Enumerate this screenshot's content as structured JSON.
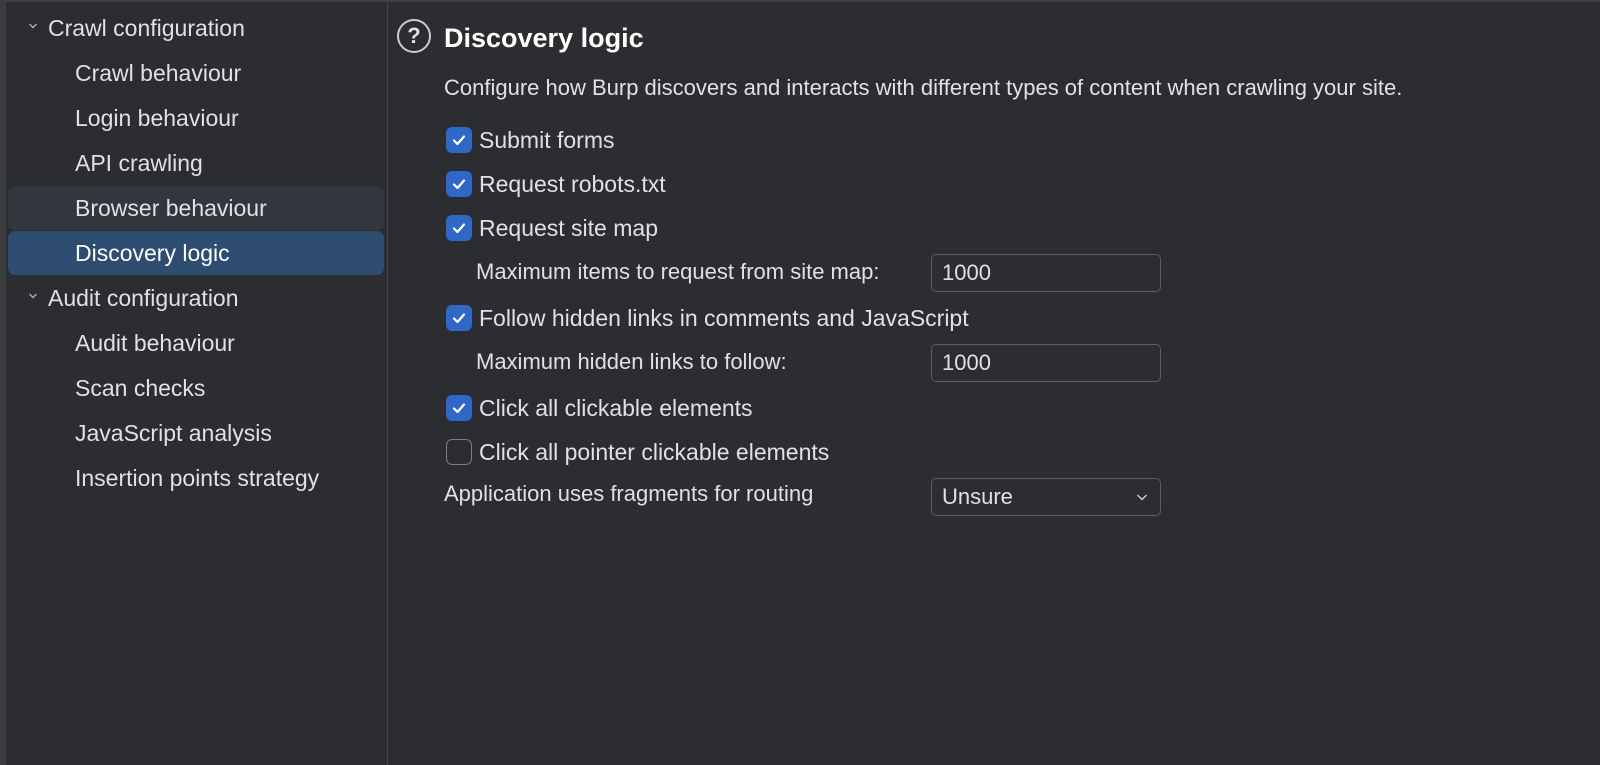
{
  "sidebar": {
    "groups": [
      {
        "label": "Crawl configuration",
        "items": [
          {
            "label": "Crawl behaviour"
          },
          {
            "label": "Login behaviour"
          },
          {
            "label": "API crawling"
          },
          {
            "label": "Browser behaviour"
          },
          {
            "label": "Discovery logic"
          }
        ]
      },
      {
        "label": "Audit configuration",
        "items": [
          {
            "label": "Audit behaviour"
          },
          {
            "label": "Scan checks"
          },
          {
            "label": "JavaScript analysis"
          },
          {
            "label": "Insertion points strategy"
          }
        ]
      }
    ],
    "selected_item": "Discovery logic",
    "hovered_item": "Browser behaviour"
  },
  "panel": {
    "help_glyph": "?",
    "title": "Discovery logic",
    "description": "Configure how Burp discovers and interacts with different types of content when crawling your site.",
    "options": {
      "submit_forms": {
        "label": "Submit forms",
        "checked": true
      },
      "request_robots": {
        "label": "Request robots.txt",
        "checked": true
      },
      "request_site_map": {
        "label": "Request site map",
        "checked": true
      },
      "follow_hidden_links": {
        "label": "Follow hidden links in comments and JavaScript",
        "checked": true
      },
      "click_all_clickable": {
        "label": "Click all clickable elements",
        "checked": true
      },
      "click_all_pointer_clickable": {
        "label": "Click all pointer clickable elements",
        "checked": false
      }
    },
    "max_site_map_items": {
      "label": "Maximum items to request from site map:",
      "value": "1000"
    },
    "max_hidden_links": {
      "label": "Maximum hidden links to follow:",
      "value": "1000"
    },
    "fragments_routing": {
      "label": "Application uses fragments for routing",
      "value": "Unsure"
    }
  },
  "colors": {
    "background": "#2b2d30",
    "selected_row": "#2e4d70",
    "hover_row": "#32363d",
    "checkbox_checked": "#2f68c7",
    "text": "#dfe1e5"
  },
  "icons": {
    "help": "help-circle-icon",
    "expand": "chevron-down-icon",
    "check": "checkmark-icon",
    "dropdown": "chevron-down-icon"
  }
}
